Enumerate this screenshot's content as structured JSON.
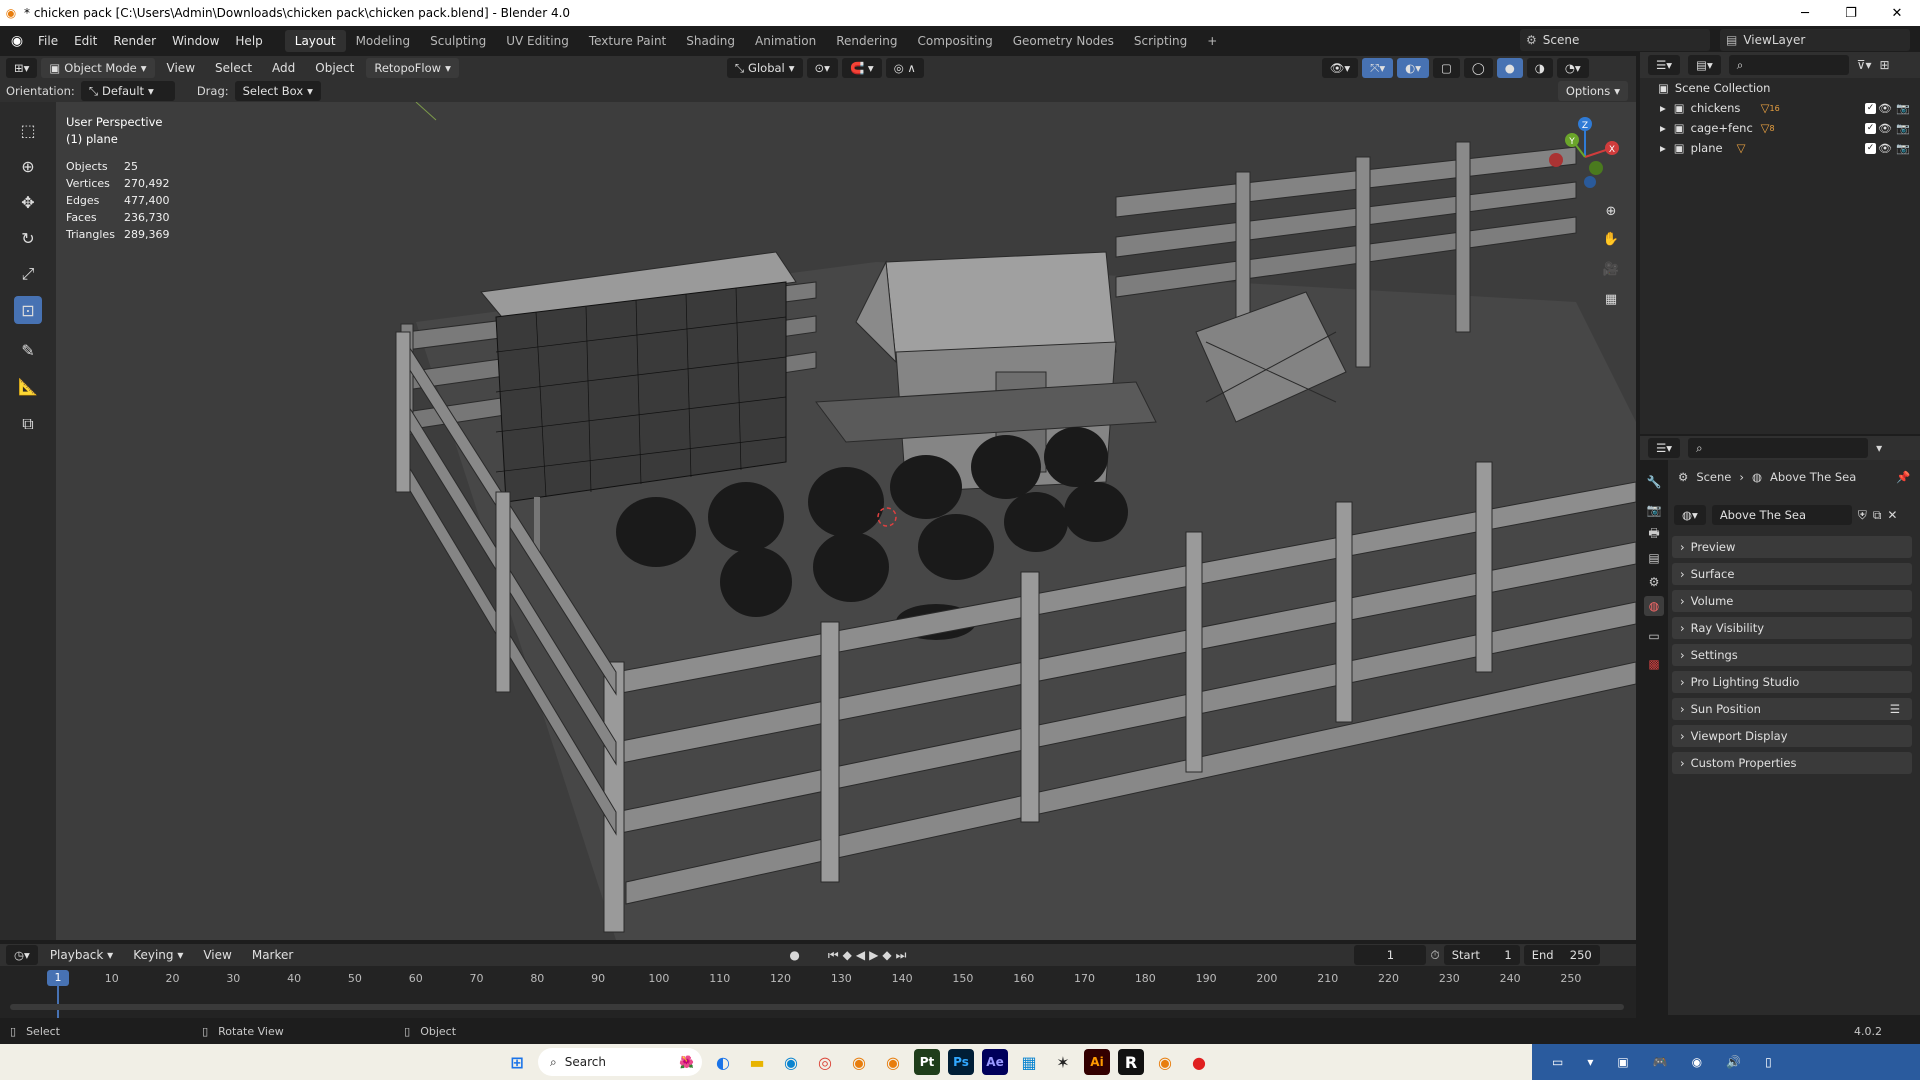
{
  "window": {
    "title": "* chicken pack [C:\\Users\\Admin\\Downloads\\chicken pack\\chicken pack.blend] - Blender 4.0",
    "minimize": "─",
    "maximize": "❐",
    "close": "✕"
  },
  "menu": [
    "File",
    "Edit",
    "Render",
    "Window",
    "Help"
  ],
  "workspaces": [
    "Layout",
    "Modeling",
    "Sculpting",
    "UV Editing",
    "Texture Paint",
    "Shading",
    "Animation",
    "Rendering",
    "Compositing",
    "Geometry Nodes",
    "Scripting"
  ],
  "workspace_add": "+",
  "scene": {
    "label": "Scene"
  },
  "view_layer": {
    "label": "ViewLayer"
  },
  "viewport_header": {
    "mode": "Object Mode",
    "view": "View",
    "select": "Select",
    "add": "Add",
    "object": "Object",
    "addon": "RetopoFlow",
    "transform": "Global"
  },
  "tool_header": {
    "orientation_label": "Orientation:",
    "orientation_value": "Default",
    "drag_label": "Drag:",
    "drag_value": "Select Box",
    "options": "Options"
  },
  "viewport": {
    "perspective": "User Perspective",
    "active_object": "(1) plane",
    "stats": [
      {
        "label": "Objects",
        "value": "25"
      },
      {
        "label": "Vertices",
        "value": "270,492"
      },
      {
        "label": "Edges",
        "value": "477,400"
      },
      {
        "label": "Faces",
        "value": "236,730"
      },
      {
        "label": "Triangles",
        "value": "289,369"
      }
    ],
    "gizmo": {
      "x": "X",
      "y": "Y",
      "z": "Z"
    }
  },
  "outliner": {
    "root": "Scene Collection",
    "items": [
      {
        "name": "chickens",
        "badge": "16"
      },
      {
        "name": "cage+fenc",
        "badge": "8"
      },
      {
        "name": "plane",
        "badge": ""
      }
    ]
  },
  "properties": {
    "breadcrumb_scene": "Scene",
    "breadcrumb_world": "Above The Sea",
    "world_name": "Above The Sea",
    "panels": [
      "Preview",
      "Surface",
      "Volume",
      "Ray Visibility",
      "Settings",
      "Pro Lighting Studio",
      "Sun Position",
      "Viewport Display",
      "Custom Properties"
    ]
  },
  "timeline": {
    "playback": "Playback",
    "keying": "Keying",
    "view": "View",
    "marker": "Marker",
    "current_frame": "1",
    "start_label": "Start",
    "start": "1",
    "end_label": "End",
    "end": "250",
    "ticks": [
      "10",
      "20",
      "30",
      "40",
      "50",
      "60",
      "70",
      "80",
      "90",
      "100",
      "110",
      "120",
      "130",
      "140",
      "150",
      "160",
      "170",
      "180",
      "190",
      "200",
      "210",
      "220",
      "230",
      "240",
      "250"
    ],
    "playhead": "1"
  },
  "statusbar": {
    "select": "Select",
    "rotate": "Rotate View",
    "object": "Object",
    "version": "4.0.2"
  },
  "taskbar": {
    "search": "Search",
    "apps": [
      "Pt",
      "Ps",
      "Ae",
      "Ai"
    ]
  }
}
